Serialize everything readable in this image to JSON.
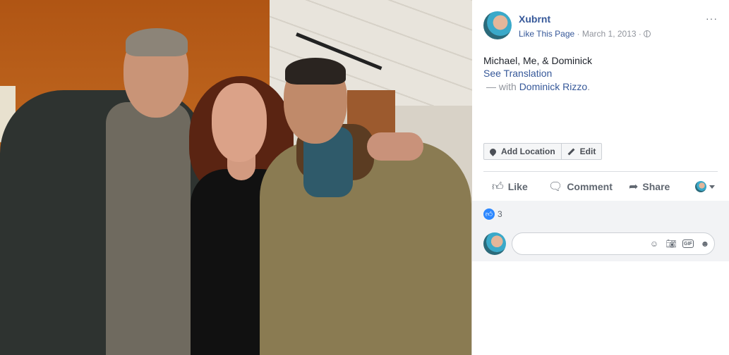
{
  "post": {
    "page_name": "Xubrnt",
    "like_page": "Like This Page",
    "separator": " · ",
    "date": "March 1, 2013",
    "more": "···",
    "caption": "Michael, Me, & Dominick",
    "see_translation": "See Translation",
    "with_prefix": "— with ",
    "tagged": "Dominick Rizzo",
    "with_suffix": "."
  },
  "buttons": {
    "add_location": "Add Location",
    "edit": "Edit"
  },
  "actions": {
    "like": "Like",
    "comment": "Comment",
    "share": "Share"
  },
  "feedback": {
    "reaction_count": "3",
    "comment_placeholder": ""
  },
  "icons": {
    "like": "thumbs-up-icon",
    "comment": "speech-bubble-icon",
    "share": "share-arrow-icon",
    "emoji": "smiley-icon",
    "camera": "camera-icon",
    "gif": "GIF",
    "sticker": "sticker-icon"
  },
  "colors": {
    "link": "#365899",
    "like_blue": "#2d88ff",
    "muted": "#90949c"
  }
}
